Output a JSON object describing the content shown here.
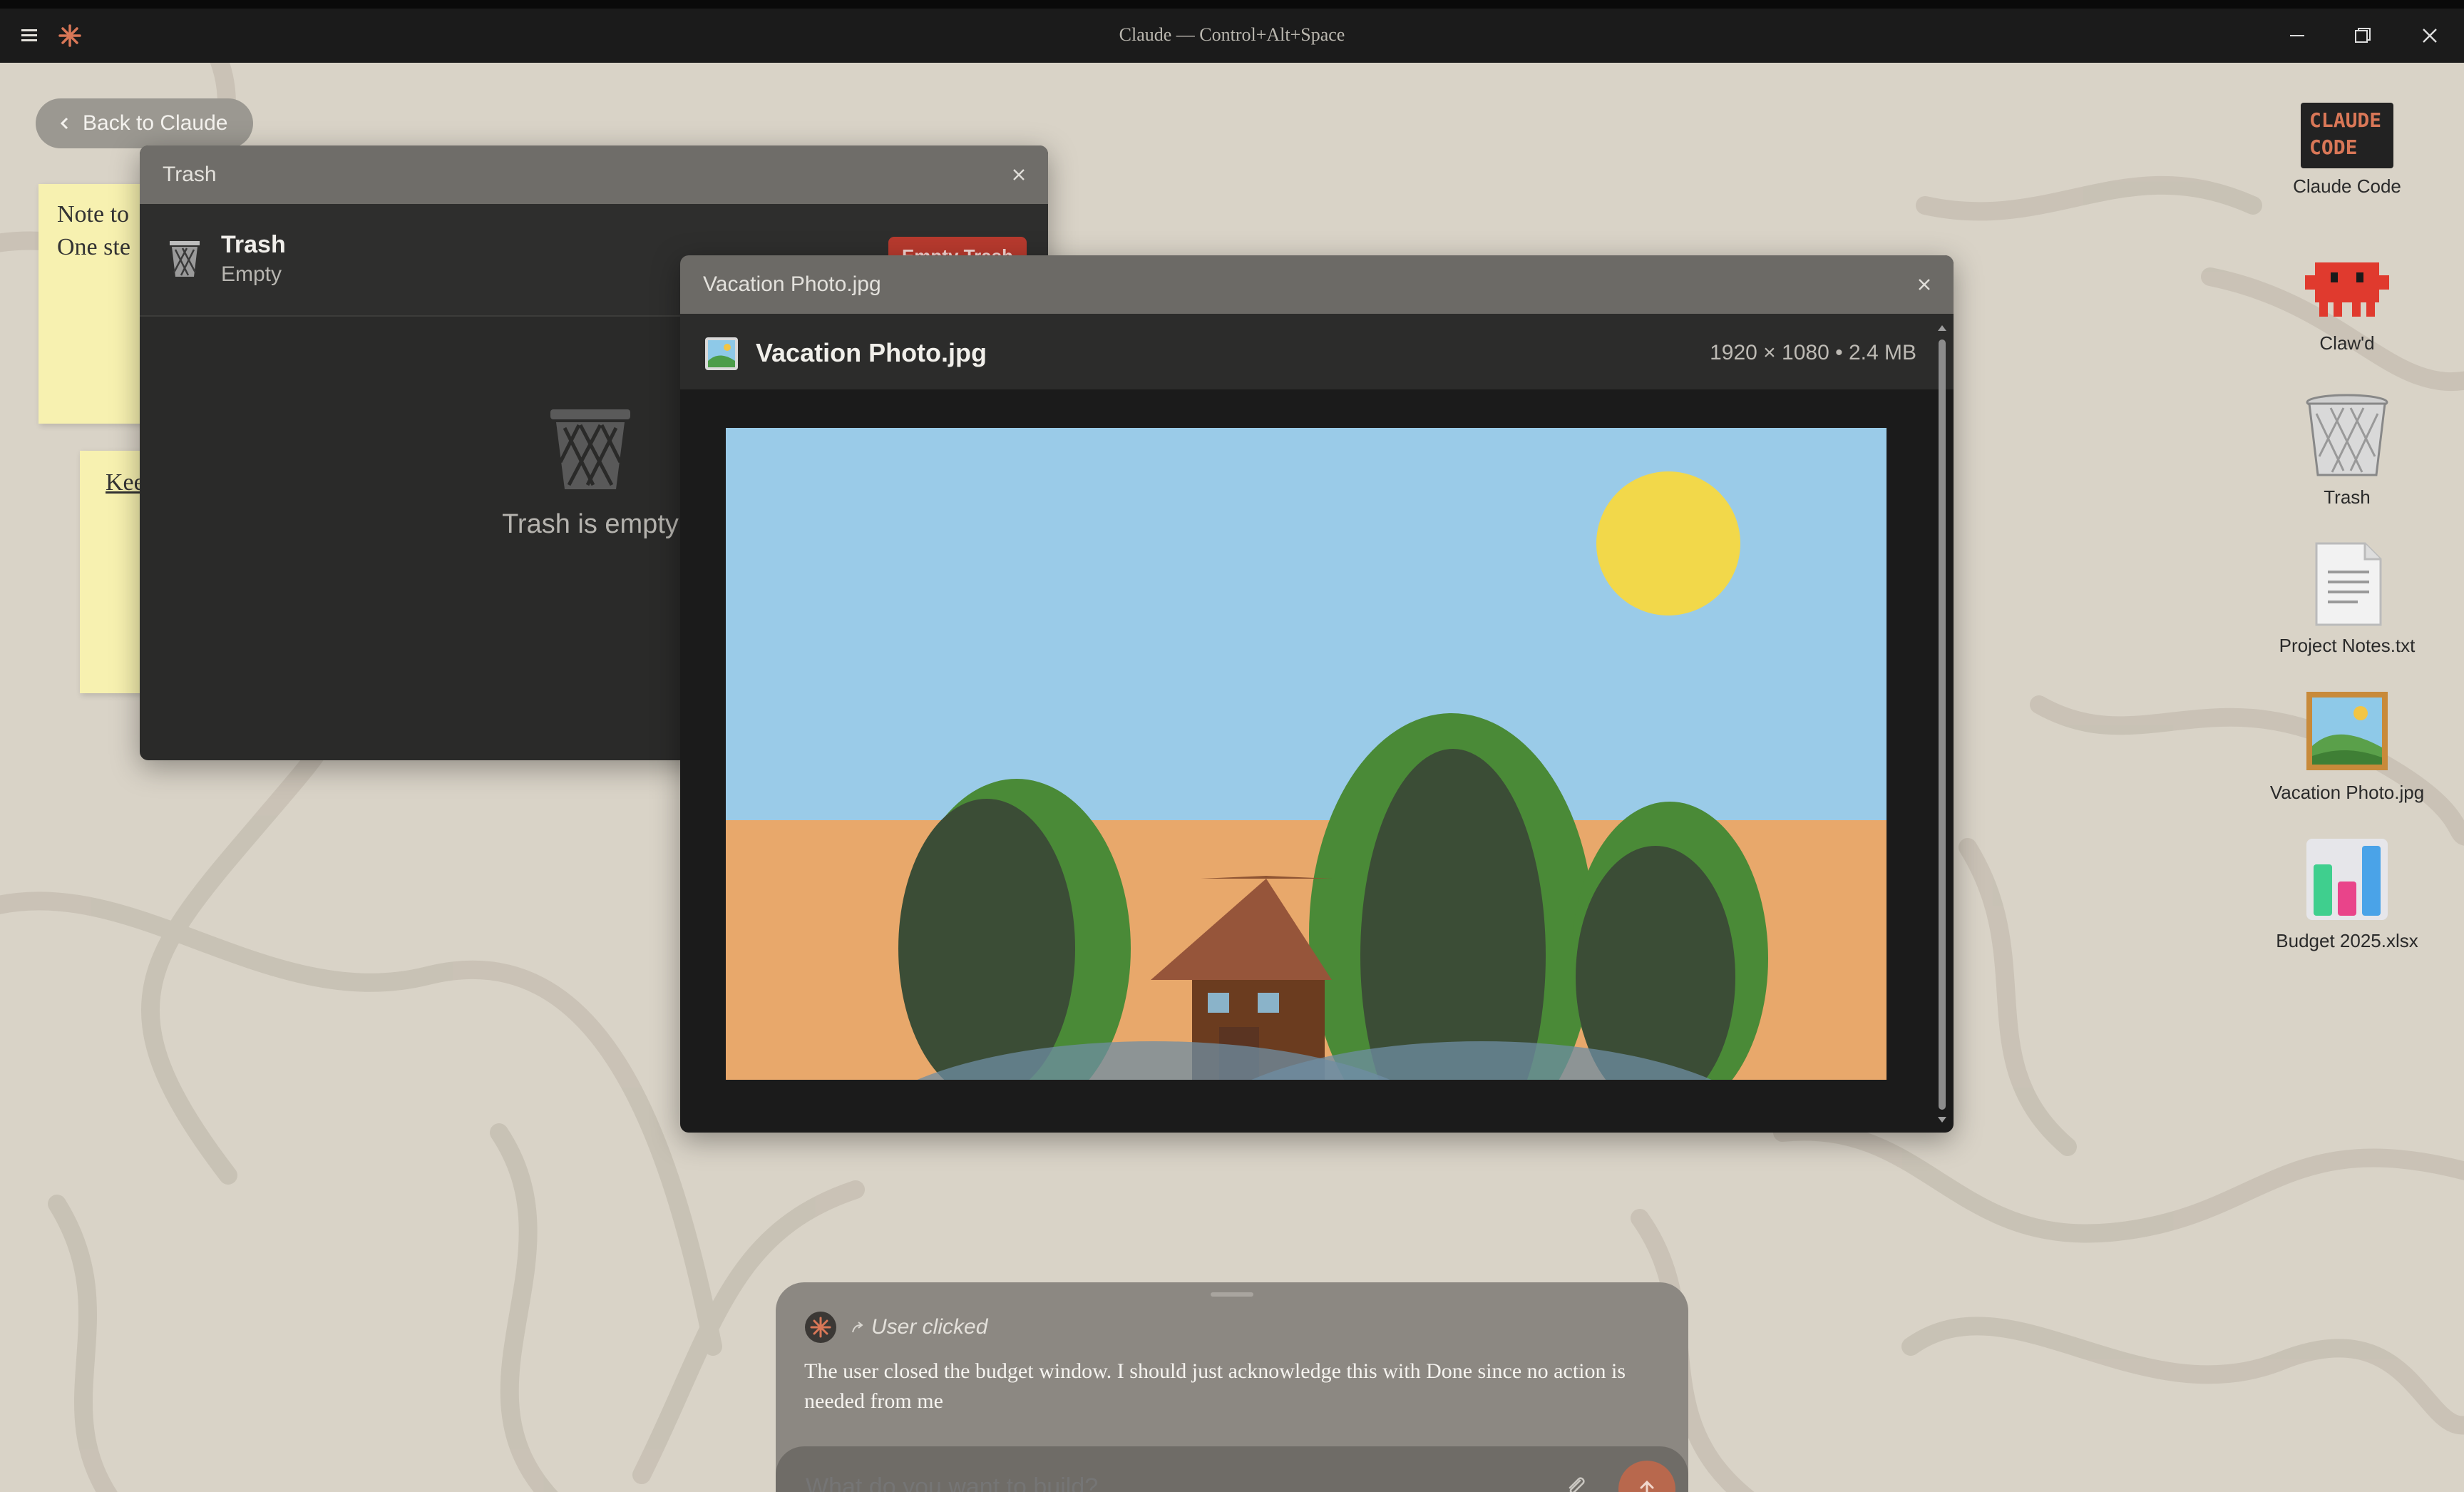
{
  "app": {
    "title": "Claude — Control+Alt+Space"
  },
  "desktop": {
    "back_button": "Back to Claude",
    "sticky_notes": [
      {
        "line1": "Note to",
        "line2": "One ste"
      },
      {
        "line1": "Kee"
      }
    ],
    "icons": [
      {
        "label": "Claude Code",
        "icon": "claude-code-icon",
        "logo_text": "CLAUDE CODE"
      },
      {
        "label": "Claw'd",
        "icon": "clawd-icon"
      },
      {
        "label": "Trash",
        "icon": "trash-icon"
      },
      {
        "label": "Project Notes.txt",
        "icon": "text-file-icon"
      },
      {
        "label": "Vacation Photo.jpg",
        "icon": "image-file-icon"
      },
      {
        "label": "Budget 2025.xlsx",
        "icon": "spreadsheet-icon"
      }
    ]
  },
  "trash_window": {
    "title": "Trash",
    "header_name": "Trash",
    "header_status": "Empty",
    "empty_button": "Empty Trash",
    "empty_message": "Trash is empty"
  },
  "photo_window": {
    "title": "Vacation Photo.jpg",
    "file_name": "Vacation Photo.jpg",
    "meta": "1920 × 1080 • 2.4 MB"
  },
  "chat": {
    "event_label": "User clicked",
    "message": "The user closed the budget window. I should just acknowledge this with Done since no action is needed from me",
    "input_placeholder": "What do you want to build?"
  },
  "colors": {
    "accent": "#d97757",
    "send_button": "#c4694d",
    "danger": "#b83a2e"
  }
}
